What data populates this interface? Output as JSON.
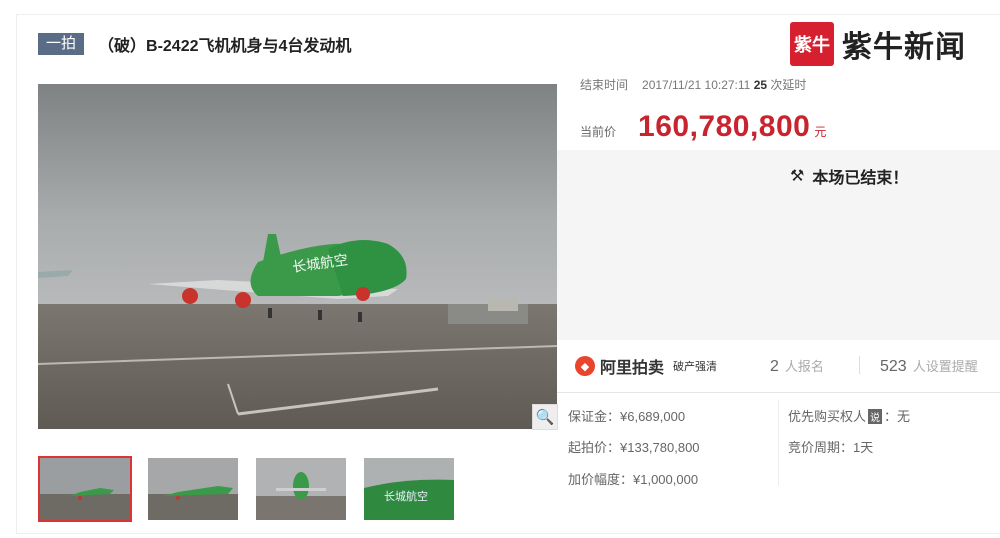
{
  "header": {
    "badge_label": "一拍",
    "title": "（破）B-2422飞机机身与4台发动机"
  },
  "brand": {
    "logo_text": "紫牛",
    "name": "紫牛新闻"
  },
  "auction": {
    "end_label": "结束时间",
    "end_time": "2017/11/21 10:27:11",
    "delay_count": "25",
    "delay_label": "次延时",
    "price_label": "当前价",
    "price": "160,780,800",
    "price_unit": "元",
    "status": "本场已结束！"
  },
  "platform": {
    "logo_glyph": "◆",
    "name": "阿里拍卖",
    "tag": "破产强清",
    "signup_count": "2",
    "signup_label": "人报名",
    "reminder_count": "523",
    "reminder_label": "人设置提醒"
  },
  "details": {
    "deposit": "保证金：¥6,689,000",
    "start_price": "起拍价：¥133,780,800",
    "increment": "加价幅度：¥1,000,000",
    "priority_prefix": "优先购买权人",
    "priority_badge": "说",
    "priority_value": "：无",
    "cycle": "竞价周期：1天"
  },
  "icons": {
    "zoom": "magnifier-icon",
    "status": "hammer-icon",
    "platform_logo": "ali-auction-icon"
  },
  "colors": {
    "badge": "#5a6c86",
    "price": "#c8242f",
    "brand_red": "#d6202f",
    "thumb_active": "#dd3333"
  }
}
